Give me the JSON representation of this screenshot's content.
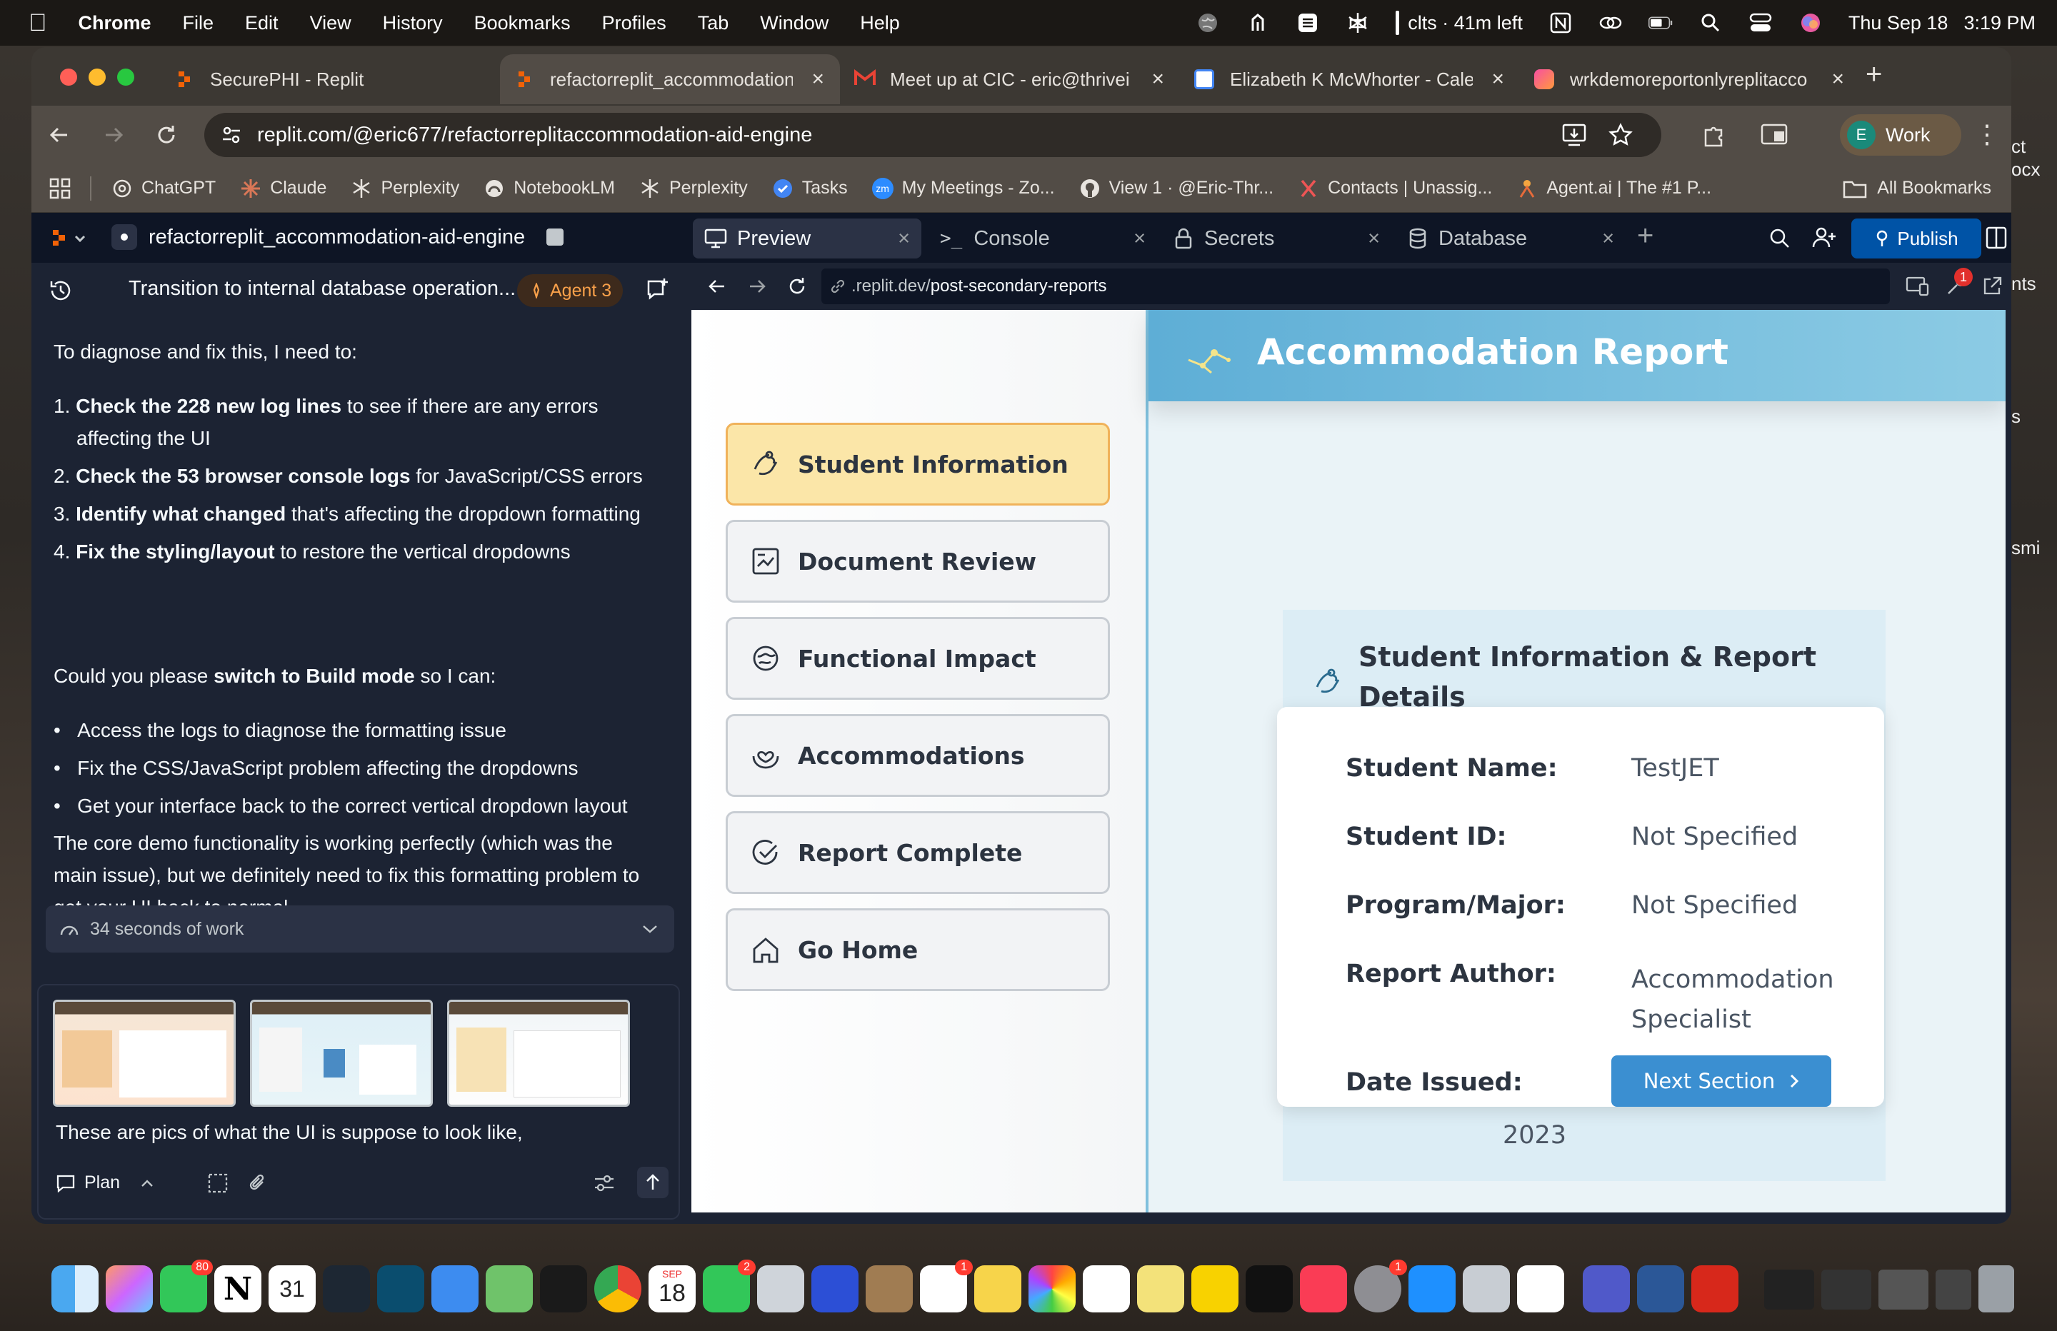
{
  "menubar": {
    "app": "Chrome",
    "items": [
      "File",
      "Edit",
      "View",
      "History",
      "Bookmarks",
      "Profiles",
      "Tab",
      "Window",
      "Help"
    ],
    "status": "clts · 41m left",
    "date": "Thu Sep 18",
    "time": "3:19 PM"
  },
  "tabs": [
    {
      "title": "SecurePHI - Replit",
      "color": "#f26207"
    },
    {
      "title": "refactorreplit_accommodation",
      "color": "#f26207"
    },
    {
      "title": "Meet up at CIC - eric@thrivei",
      "color": "#ea4335"
    },
    {
      "title": "Elizabeth K McWhorter - Cale",
      "color": "#4285f4"
    },
    {
      "title": "wrkdemoreportonlyreplitacco",
      "color": "#a142f4"
    }
  ],
  "omnibox": {
    "url": "replit.com/@eric677/refactorreplitaccommodation-aid-engine"
  },
  "profile": {
    "initial": "E",
    "label": "Work"
  },
  "bookmarks": [
    "ChatGPT",
    "Claude",
    "Perplexity",
    "NotebookLM",
    "Perplexity",
    "Tasks",
    "My Meetings - Zo...",
    "View 1 · @Eric-Thr...",
    "Contacts | Unassig...",
    "Agent.ai | The #1 P..."
  ],
  "all_bookmarks": "All Bookmarks",
  "replit": {
    "project": "refactorreplit_accommodation-aid-engine",
    "tabs": [
      "Preview",
      "Console",
      "Secrets",
      "Database"
    ],
    "publish": "Publish",
    "notification_count": "1",
    "preview_url_domain": ".replit.dev/",
    "preview_url_path": "post-secondary-reports"
  },
  "agent": {
    "thread_title": "Transition to internal database operation...",
    "badge": "Agent 3",
    "intro": "To diagnose and fix this, I need to:",
    "steps": [
      {
        "num": "1.",
        "bold": "Check the 228 new log lines",
        "rest": " to see if there are any errors"
      },
      {
        "num": "",
        "bold": "",
        "rest": "affecting the UI"
      },
      {
        "num": "2.",
        "bold": "Check the 53 browser console logs",
        "rest": " for JavaScript/CSS errors"
      },
      {
        "num": "3.",
        "bold": "Identify what changed",
        "rest": " that's affecting the dropdown formatting"
      },
      {
        "num": "4.",
        "bold": "Fix the styling/layout",
        "rest": " to restore the vertical dropdowns"
      }
    ],
    "ask_pre": "Could you please ",
    "ask_bold": "switch to Build mode",
    "ask_post": " so I can:",
    "bullets": [
      "Access the logs to diagnose the formatting issue",
      "Fix the CSS/JavaScript problem affecting the dropdowns",
      "Get your interface back to the correct vertical dropdown layout"
    ],
    "closing": [
      "The core demo functionality is working perfectly (which was the",
      "main issue), but we definitely need to fix this formatting problem to",
      "get your UI back to normal."
    ],
    "work": "34 seconds of work",
    "input_text": "These are pics of what the UI is suppose to look like,",
    "plan": "Plan"
  },
  "app": {
    "header_title": "Accommodation Report",
    "nav": [
      {
        "label": "Student Information",
        "active": true
      },
      {
        "label": "Document Review",
        "active": false
      },
      {
        "label": "Functional Impact",
        "active": false
      },
      {
        "label": "Accommodations",
        "active": false
      },
      {
        "label": "Report Complete",
        "active": false
      },
      {
        "label": "Go Home",
        "active": false
      }
    ],
    "card_title_1": "Student Information & Report",
    "card_title_2": "Details",
    "fields": [
      {
        "label": "Student Name:",
        "value": "TestJET"
      },
      {
        "label": "Student ID:",
        "value": "Not Specified"
      },
      {
        "label": "Program/Major:",
        "value": "Not Specified"
      },
      {
        "label": "Report Author:",
        "value": "Accommodation",
        "value2": "Specialist"
      },
      {
        "label": "Date Issued:",
        "value": "2023"
      }
    ],
    "next_button": "Next Section"
  },
  "desktop_right": [
    "ct",
    "ocx",
    "nts",
    "s",
    "smi"
  ],
  "dock_badges": {
    "messages": "80",
    "calendar_day": "31",
    "sep": "SEP",
    "sep_day": "18",
    "facetime": "2",
    "reminders": "1",
    "settings": "1"
  }
}
